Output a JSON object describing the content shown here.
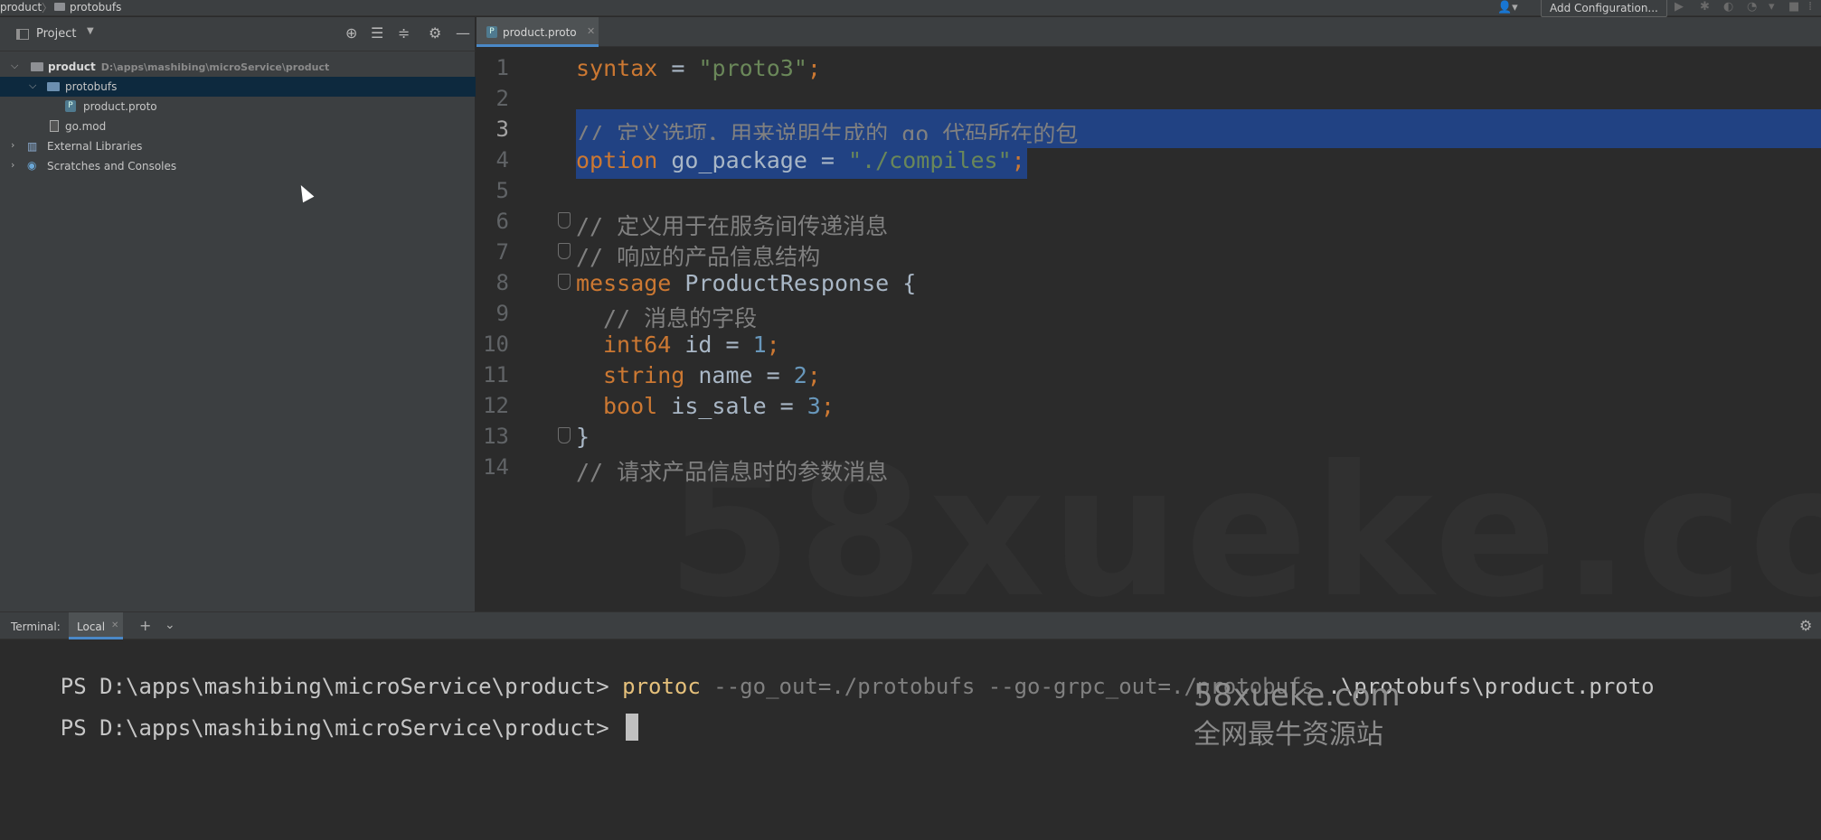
{
  "breadcrumb": {
    "root": "product",
    "child": "protobufs"
  },
  "toolbar": {
    "add_configuration": "Add Configuration..."
  },
  "project": {
    "title": "Project",
    "tree": [
      {
        "label": "product",
        "path": "D:\\apps\\mashibing\\microService\\product",
        "icon": "folder-icon"
      },
      {
        "label": "protobufs",
        "icon": "folder-icon"
      },
      {
        "label": "product.proto",
        "icon": "proto-file-icon"
      },
      {
        "label": "go.mod",
        "icon": "go-mod-file-icon"
      },
      {
        "label": "External Libraries",
        "icon": "library-icon"
      },
      {
        "label": "Scratches and Consoles",
        "icon": "scratches-icon"
      }
    ]
  },
  "editor": {
    "tab_label": "product.proto",
    "line_numbers": [
      "1",
      "2",
      "3",
      "4",
      "5",
      "6",
      "7",
      "8",
      "9",
      "10",
      "11",
      "12",
      "13",
      "14"
    ],
    "code": {
      "l1": {
        "kw": "syntax",
        "eq": " = ",
        "str": "\"proto3\"",
        "end": ";"
      },
      "l3": "// 定义选项，用来说明生成的 go 代码所在的包",
      "l4": {
        "kw": "option",
        "name": " go_package = ",
        "str": "\"./compiles\"",
        "end": ";"
      },
      "l6": "// 定义用于在服务间传递消息",
      "l7": "// 响应的产品信息结构",
      "l8": {
        "kw": "message",
        "name": " ProductResponse {"
      },
      "l9": "// 消息的字段",
      "l10": {
        "kw": "int64",
        "name": " id = ",
        "num": "1",
        "end": ";"
      },
      "l11": {
        "kw": "string",
        "name": " name = ",
        "num": "2",
        "end": ";"
      },
      "l12": {
        "kw": "bool",
        "name": " is_sale = ",
        "num": "3",
        "end": ";"
      },
      "l13": "}",
      "l14": "// 请求产品信息时的参数消息"
    },
    "watermark": "58xueke.com"
  },
  "terminal": {
    "label": "Terminal:",
    "tab": "Local",
    "line1": {
      "prompt": "PS D:\\apps\\mashibing\\microService\\product> ",
      "cmd": "protoc",
      "flags": " --go_out=./protobufs --go-grpc_out=./protobufs",
      "arg": " .\\protobufs\\product.proto"
    },
    "line2_prompt": "PS D:\\apps\\mashibing\\microService\\product> ",
    "watermark_site": "58xueke.com",
    "watermark_slogan": "全网最牛资源站"
  }
}
